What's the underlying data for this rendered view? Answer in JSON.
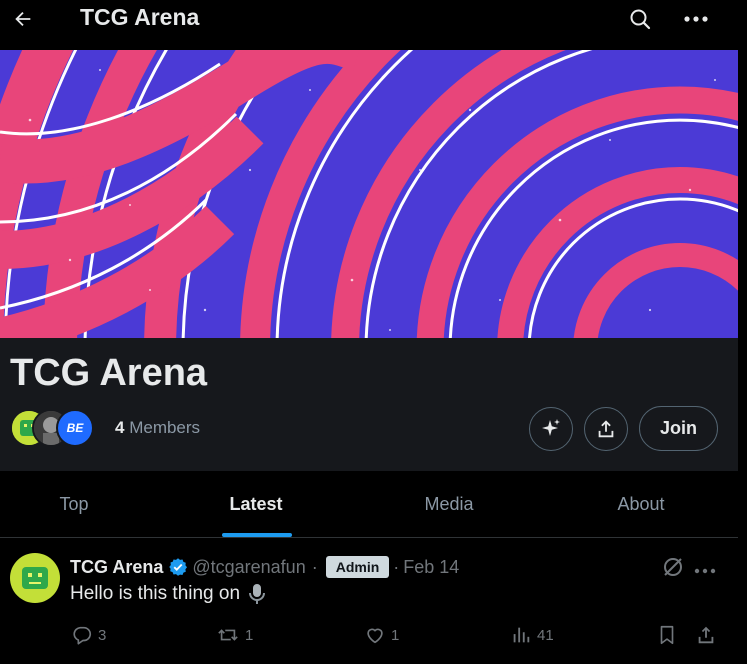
{
  "topbar": {
    "title": "TCG Arena",
    "back_icon": "arrow-left-icon",
    "search_icon": "search-icon",
    "more_icon": "more-horizontal-icon"
  },
  "banner": {
    "description": "",
    "colors": {
      "blue": "#4a36d8",
      "pink": "#e8457a"
    }
  },
  "community": {
    "name": "TCG Arena",
    "member_count": "4",
    "members_label": "Members",
    "member_avatar_3_text": "BE",
    "join_label": "Join"
  },
  "tabs": [
    {
      "label": "Top",
      "active": false
    },
    {
      "label": "Latest",
      "active": true
    },
    {
      "label": "Media",
      "active": false
    },
    {
      "label": "About",
      "active": false
    }
  ],
  "post": {
    "author": "TCG Arena",
    "handle": "@tcgarenafun",
    "separator": "·",
    "badge": "Admin",
    "date": "Feb 14",
    "text": "Hello is this thing on",
    "text_emoji": "microphone-icon",
    "actions": {
      "replies": "3",
      "reposts": "1",
      "likes": "1",
      "views": "41"
    }
  },
  "colors": {
    "accent": "#1d9bf0",
    "background": "#000000",
    "header_bg": "#16181c",
    "muted_text": "#71767b"
  }
}
